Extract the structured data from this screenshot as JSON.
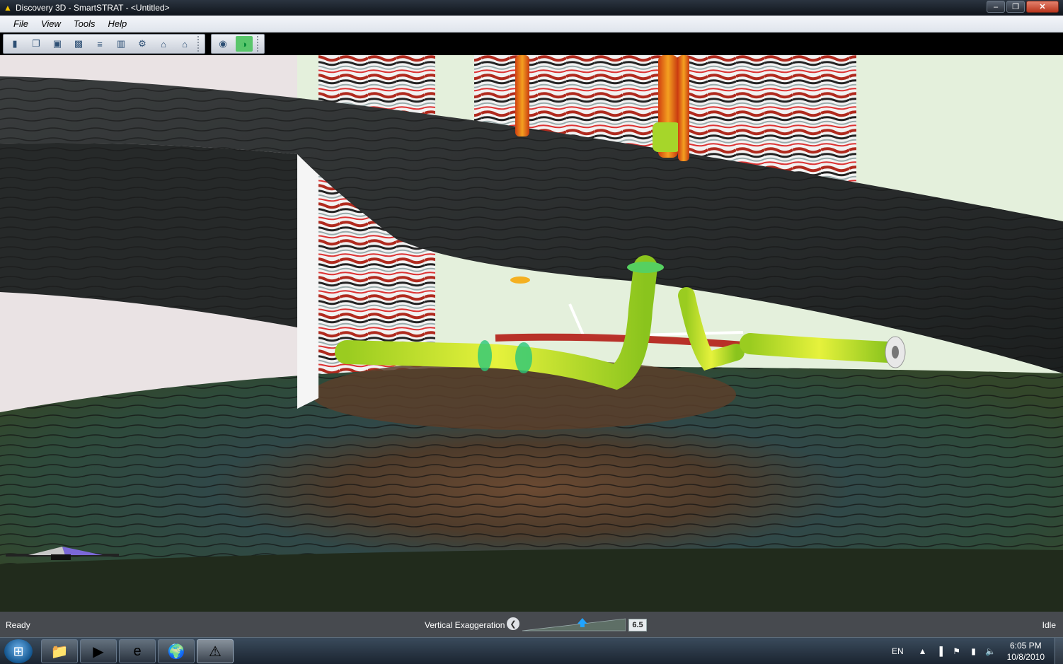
{
  "window": {
    "title": "Discovery 3D - SmartSTRAT - <Untitled>",
    "app_icon": "warning-triangle-icon",
    "controls": {
      "minimize": "–",
      "restore": "❐",
      "close": "✕"
    }
  },
  "menu": {
    "items": [
      {
        "label": "File"
      },
      {
        "label": "View"
      },
      {
        "label": "Tools"
      },
      {
        "label": "Help"
      }
    ]
  },
  "toolbar": {
    "buttons": [
      {
        "name": "new-icon",
        "glyph": "▮"
      },
      {
        "name": "open-folder-icon",
        "glyph": "❐"
      },
      {
        "name": "save-icon",
        "glyph": "▣"
      },
      {
        "name": "snapshot-icon",
        "glyph": "▩"
      },
      {
        "name": "layers-icon",
        "glyph": "≡"
      },
      {
        "name": "panel-icon",
        "glyph": "▥"
      },
      {
        "name": "settings-icon",
        "glyph": "⚙"
      },
      {
        "name": "home-icon",
        "glyph": "⌂"
      },
      {
        "name": "home-reset-icon",
        "glyph": "⌂"
      }
    ],
    "buttons2": [
      {
        "name": "camera-icon",
        "glyph": "◉"
      },
      {
        "name": "toggle-view-icon",
        "glyph": "◑",
        "active": true
      }
    ]
  },
  "status": {
    "left": "Ready",
    "right": "Idle",
    "vertical_exaggeration_label": "Vertical Exaggeration",
    "vertical_exaggeration_value": "6.5",
    "slider_fraction": 0.59,
    "left_button_glyph": "❮"
  },
  "taskbar": {
    "start_glyph": "⊞",
    "apps": [
      {
        "name": "explorer-icon",
        "glyph": "📁"
      },
      {
        "name": "media-player-icon",
        "glyph": "▶"
      },
      {
        "name": "internet-explorer-icon",
        "glyph": "e"
      },
      {
        "name": "globe-icon",
        "glyph": "🌍"
      },
      {
        "name": "discovery-3d-icon",
        "glyph": "⚠",
        "active": true
      }
    ],
    "tray": {
      "lang": "EN",
      "icons": [
        {
          "name": "show-hidden-icon",
          "glyph": "▲"
        },
        {
          "name": "network-icon",
          "glyph": "▐"
        },
        {
          "name": "action-center-flag-icon",
          "glyph": "⚑"
        },
        {
          "name": "power-icon",
          "glyph": "▮"
        },
        {
          "name": "volume-icon",
          "glyph": "🔈"
        }
      ],
      "time": "6:05 PM",
      "date": "10/8/2010"
    }
  }
}
